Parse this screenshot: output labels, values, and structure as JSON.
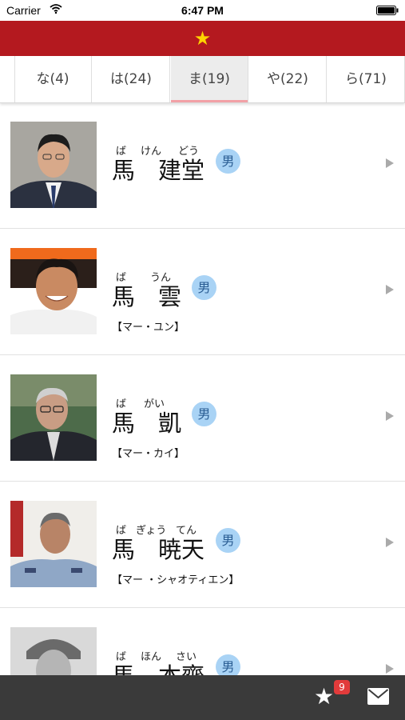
{
  "status_bar": {
    "carrier": "Carrier",
    "time": "6:47 PM"
  },
  "header": {
    "icon": "star-icon",
    "accent_color": "#b4191f",
    "star_color": "#ffd400"
  },
  "tabs": [
    {
      "label": "な(4)",
      "active": false
    },
    {
      "label": "は(24)",
      "active": false
    },
    {
      "label": "ま(19)",
      "active": true
    },
    {
      "label": "や(22)",
      "active": false
    },
    {
      "label": "ら(71)",
      "active": false
    }
  ],
  "people": [
    {
      "ruby": [
        "ば",
        "けん",
        "どう"
      ],
      "name": [
        "馬",
        "建",
        "堂"
      ],
      "gender": "男",
      "kana": ""
    },
    {
      "ruby": [
        "ば",
        "うん"
      ],
      "name": [
        "馬",
        "雲"
      ],
      "gender": "男",
      "kana": "【マー・ユン】"
    },
    {
      "ruby": [
        "ば",
        "がい"
      ],
      "name": [
        "馬",
        "凱"
      ],
      "gender": "男",
      "kana": "【マー・カイ】"
    },
    {
      "ruby": [
        "ば",
        "ぎょう",
        "てん"
      ],
      "name": [
        "馬",
        "暁",
        "天"
      ],
      "gender": "男",
      "kana": "【マー ・シャオティエン】"
    },
    {
      "ruby": [
        "ば",
        "ほん",
        "さい"
      ],
      "name": [
        "馬",
        "本",
        "齋"
      ],
      "gender": "男",
      "kana": ""
    }
  ],
  "bottom_bar": {
    "favorites_icon": "star-icon",
    "favorites_count": "9",
    "mail_icon": "mail-icon",
    "badge_color": "#e23b3b"
  }
}
